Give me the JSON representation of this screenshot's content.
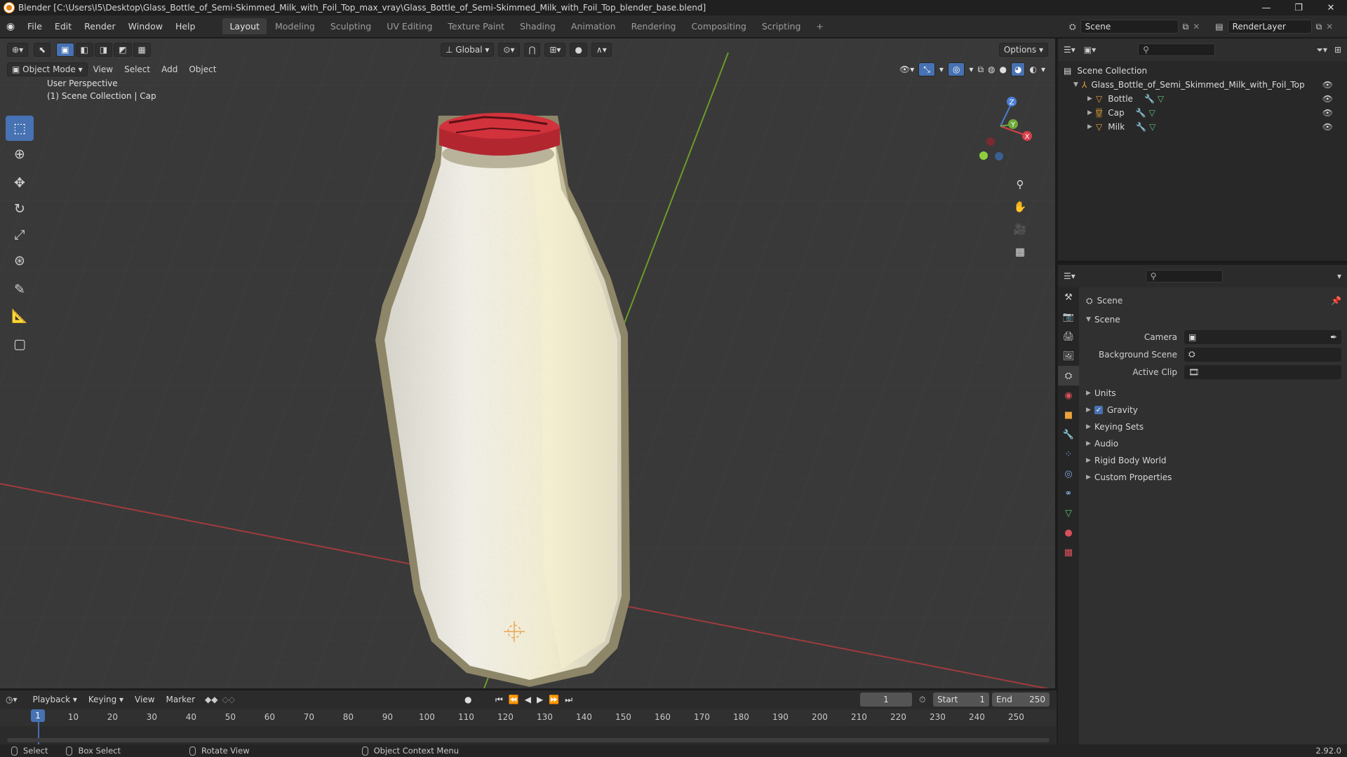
{
  "window": {
    "title": "Blender [C:\\Users\\I5\\Desktop\\Glass_Bottle_of_Semi-Skimmed_Milk_with_Foil_Top_max_vray\\Glass_Bottle_of_Semi-Skimmed_Milk_with_Foil_Top_blender_base.blend]",
    "minimize": "—",
    "restore": "❐",
    "close": "✕"
  },
  "menu": {
    "items": [
      "File",
      "Edit",
      "Render",
      "Window",
      "Help"
    ],
    "workspaces": [
      "Layout",
      "Modeling",
      "Sculpting",
      "UV Editing",
      "Texture Paint",
      "Shading",
      "Animation",
      "Rendering",
      "Compositing",
      "Scripting"
    ],
    "add_workspace": "+"
  },
  "scene_selector": {
    "value": "Scene"
  },
  "renderlayer_selector": {
    "value": "RenderLayer"
  },
  "viewport": {
    "mode": "Object Mode",
    "menus": [
      "View",
      "Select",
      "Add",
      "Object"
    ],
    "transform_orientation": "Global",
    "options": "Options",
    "info_line1": "User Perspective",
    "info_line2": "(1) Scene Collection | Cap",
    "gizmo_labels": {
      "z": "Z",
      "y": "Y",
      "x": "X"
    },
    "colors": {
      "background": "#393939",
      "grid": "#444444",
      "x_axis": "#a03b3f",
      "y_axis": "#6b9b2a",
      "cap": "#d1323c",
      "milk": "#f2efe3",
      "select": "#4772b3"
    }
  },
  "outliner": {
    "root": "Scene Collection",
    "collection": "Glass_Bottle_of_Semi_Skimmed_Milk_with_Foil_Top",
    "objects": [
      "Bottle",
      "Cap",
      "Milk"
    ]
  },
  "properties": {
    "context": "Scene",
    "section": "Scene",
    "fields": [
      {
        "label": "Camera",
        "value": ""
      },
      {
        "label": "Background Scene",
        "value": ""
      },
      {
        "label": "Active Clip",
        "value": ""
      }
    ],
    "panels": [
      "Units",
      "Gravity",
      "Keying Sets",
      "Audio",
      "Rigid Body World",
      "Custom Properties"
    ],
    "gravity_checked": true
  },
  "timeline": {
    "menus": [
      "Playback",
      "Keying",
      "View",
      "Marker"
    ],
    "current_frame": "1",
    "start_label": "Start",
    "start": "1",
    "end_label": "End",
    "end": "250",
    "ticks": [
      "1",
      "10",
      "20",
      "30",
      "40",
      "50",
      "60",
      "70",
      "80",
      "90",
      "100",
      "110",
      "120",
      "130",
      "140",
      "150",
      "160",
      "170",
      "180",
      "190",
      "200",
      "210",
      "220",
      "230",
      "240",
      "250"
    ]
  },
  "status": {
    "select": "Select",
    "box_select": "Box Select",
    "rotate": "Rotate View",
    "context_menu": "Object Context Menu",
    "version": "2.92.0"
  }
}
